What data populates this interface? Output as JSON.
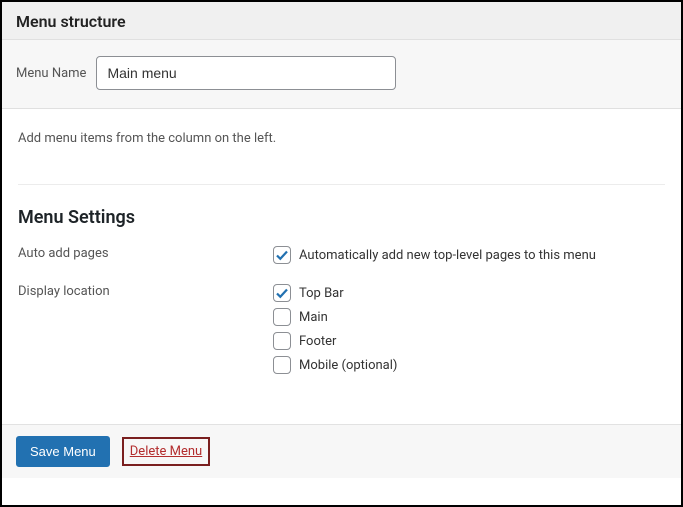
{
  "header": {
    "title": "Menu structure"
  },
  "menu_name": {
    "label": "Menu Name",
    "value": "Main menu"
  },
  "instruction": "Add menu items from the column on the left.",
  "settings": {
    "title": "Menu Settings",
    "auto_add": {
      "label": "Auto add pages",
      "option_label": "Automatically add new top-level pages to this menu",
      "checked": true
    },
    "display_location": {
      "label": "Display location",
      "options": [
        {
          "label": "Top Bar",
          "checked": true
        },
        {
          "label": "Main",
          "checked": false
        },
        {
          "label": "Footer",
          "checked": false
        },
        {
          "label": "Mobile (optional)",
          "checked": false
        }
      ]
    }
  },
  "footer": {
    "save_label": "Save Menu",
    "delete_label": "Delete Menu"
  }
}
